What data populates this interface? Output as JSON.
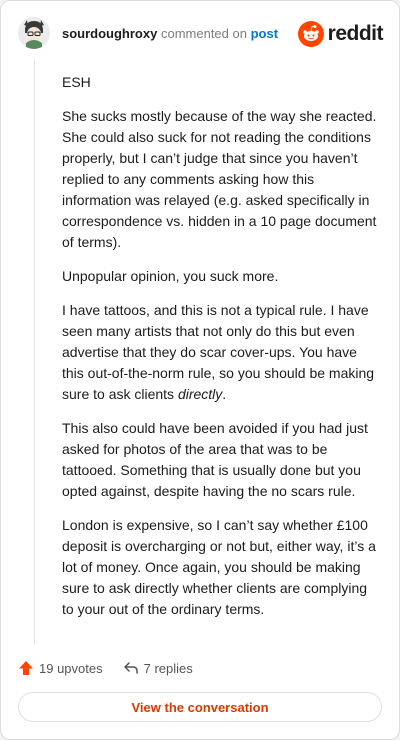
{
  "header": {
    "username": "sourdoughroxy",
    "action": "commented on",
    "link": "post",
    "logo_text": "reddit"
  },
  "comment": {
    "paragraphs": [
      "ESH",
      "She sucks mostly because of the way she reacted. She could also suck for not reading the conditions properly, but I can’t judge that since you haven’t replied to any comments asking how this information was relayed (e.g. asked specifically in correspondence vs. hidden in a 10 page document of terms).",
      "Unpopular opinion, you suck more.",
      "I have tattoos, and this is not a typical rule. I have seen many artists that not only do this but even advertise that they do scar cover-ups. You have this out-of-the-norm rule, so you should be making sure to ask clients ",
      "This also could have been avoided if you had just asked for photos of the area that was to be tattooed. Something that is usually done but you opted against, despite having the no scars rule.",
      "London is expensive, so I can’t say whether £100 deposit is overcharging or not but, either way, it’s a lot of money. Once again, you should be making sure to ask directly whether clients are complying to your out of the ordinary terms."
    ],
    "emphasis": "directly",
    "emphasis_tail": "."
  },
  "footer": {
    "upvotes": "19 upvotes",
    "replies": "7 replies",
    "button": "View the conversation"
  },
  "colors": {
    "upvote": "#ff4500",
    "link": "#0079d3",
    "button_text": "#d93a00"
  }
}
